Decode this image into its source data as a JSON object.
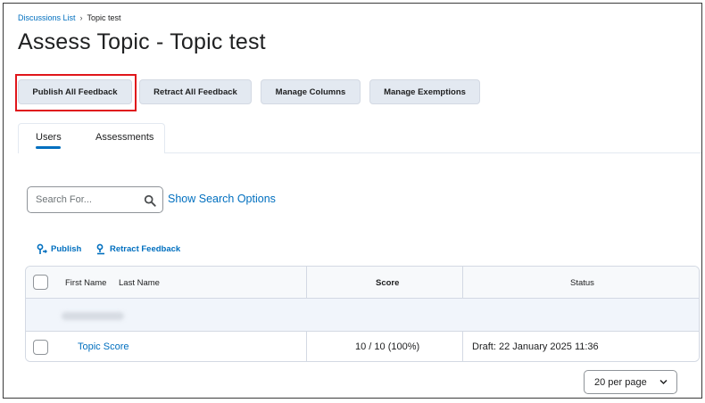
{
  "breadcrumb": {
    "parent": "Discussions List",
    "separator": "›",
    "current": "Topic test"
  },
  "page_title": "Assess Topic - Topic test",
  "toolbar": {
    "publish_all": "Publish All Feedback",
    "retract_all": "Retract All Feedback",
    "manage_columns": "Manage Columns",
    "manage_exemptions": "Manage Exemptions"
  },
  "tabs": [
    {
      "label": "Users",
      "selected": true
    },
    {
      "label": "Assessments",
      "selected": false
    }
  ],
  "search": {
    "placeholder": "Search For...",
    "options_link": "Show Search Options"
  },
  "actions": {
    "publish": "Publish",
    "retract": "Retract Feedback"
  },
  "table": {
    "headers": {
      "first_name": "First Name",
      "last_name": "Last Name",
      "score": "Score",
      "status": "Status"
    },
    "rows": [
      {
        "name": "Topic Score",
        "score": "10 / 10 (100%)",
        "status": "Draft: 22 January 2025 11:36"
      }
    ]
  },
  "pagination": {
    "per_page": "20 per page"
  },
  "colors": {
    "accent": "#006fbf",
    "highlight": "#e0161b",
    "button_bg": "#e3e9f1"
  },
  "icons": {
    "search": "search-icon",
    "publish": "publish-icon",
    "retract": "retract-icon",
    "dropdown": "chevron-down-icon"
  }
}
